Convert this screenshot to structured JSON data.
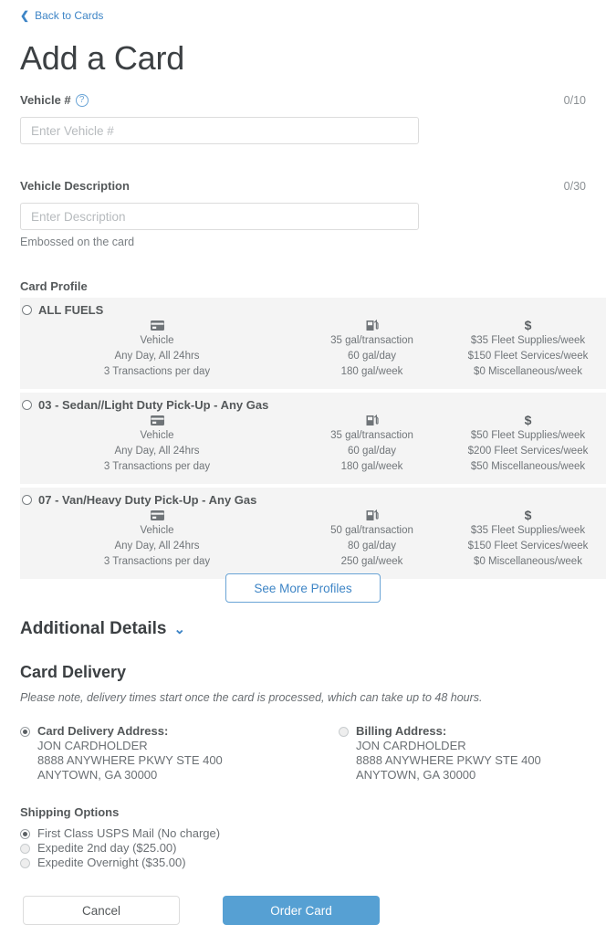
{
  "back_link": {
    "label": "Back to Cards",
    "icon": "chevron-left-icon"
  },
  "page_title": "Add a Card",
  "fields": {
    "vehicle": {
      "label": "Vehicle #",
      "help_icon": "?",
      "counter": "0/10",
      "placeholder": "Enter Vehicle #",
      "value": ""
    },
    "description": {
      "label": "Vehicle Description",
      "counter": "0/30",
      "placeholder": "Enter Description",
      "value": "",
      "hint": "Embossed on the card"
    }
  },
  "card_profile": {
    "section_label": "Card Profile",
    "profiles": [
      {
        "title": "ALL FUELS",
        "selected": false,
        "vehicle_icon": "credit-card-icon",
        "fuel_icon": "fuel-pump-icon",
        "money_icon": "$",
        "vehicle_lines": [
          "Vehicle",
          "Any Day, All 24hrs",
          "3 Transactions per day"
        ],
        "fuel_lines": [
          "35 gal/transaction",
          "60 gal/day",
          "180 gal/week"
        ],
        "money_lines": [
          "$35 Fleet Supplies/week",
          "$150 Fleet Services/week",
          "$0 Miscellaneous/week"
        ]
      },
      {
        "title": "03 - Sedan//Light Duty Pick-Up - Any Gas",
        "selected": false,
        "vehicle_icon": "credit-card-icon",
        "fuel_icon": "fuel-pump-icon",
        "money_icon": "$",
        "vehicle_lines": [
          "Vehicle",
          "Any Day, All 24hrs",
          "3 Transactions per day"
        ],
        "fuel_lines": [
          "35 gal/transaction",
          "60 gal/day",
          "180 gal/week"
        ],
        "money_lines": [
          "$50 Fleet Supplies/week",
          "$200 Fleet Services/week",
          "$50 Miscellaneous/week"
        ]
      },
      {
        "title": "07 - Van/Heavy Duty Pick-Up - Any Gas",
        "selected": false,
        "vehicle_icon": "credit-card-icon",
        "fuel_icon": "fuel-pump-icon",
        "money_icon": "$",
        "vehicle_lines": [
          "Vehicle",
          "Any Day, All 24hrs",
          "3 Transactions per day"
        ],
        "fuel_lines": [
          "50 gal/transaction",
          "80 gal/day",
          "250 gal/week"
        ],
        "money_lines": [
          "$35 Fleet Supplies/week",
          "$150 Fleet Services/week",
          "$0 Miscellaneous/week"
        ]
      }
    ],
    "see_more_label": "See More Profiles"
  },
  "additional_details": {
    "label": "Additional Details",
    "chevron_icon": "chevron-down-icon"
  },
  "card_delivery": {
    "title": "Card Delivery",
    "note": "Please note, delivery times start once the card is processed, which can take up to 48 hours.",
    "delivery_address": {
      "label": "Card Delivery Address:",
      "selected": true,
      "lines": [
        "JON CARDHOLDER",
        "8888 ANYWHERE PKWY STE 400",
        "ANYTOWN, GA 30000"
      ]
    },
    "billing_address": {
      "label": "Billing Address:",
      "selected": false,
      "lines": [
        "JON CARDHOLDER",
        "8888 ANYWHERE PKWY STE 400",
        "ANYTOWN, GA 30000"
      ]
    }
  },
  "shipping": {
    "title": "Shipping Options",
    "options": [
      {
        "label": "First Class USPS Mail (No charge)",
        "selected": true
      },
      {
        "label": "Expedite 2nd day ($25.00)",
        "selected": false
      },
      {
        "label": "Expedite Overnight ($35.00)",
        "selected": false
      }
    ]
  },
  "footer": {
    "cancel_label": "Cancel",
    "order_label": "Order Card"
  },
  "colors": {
    "accent_blue": "#3e85c6",
    "primary_button": "#56a0d3",
    "profile_bg": "#f4f4f4",
    "text": "#54585a"
  }
}
